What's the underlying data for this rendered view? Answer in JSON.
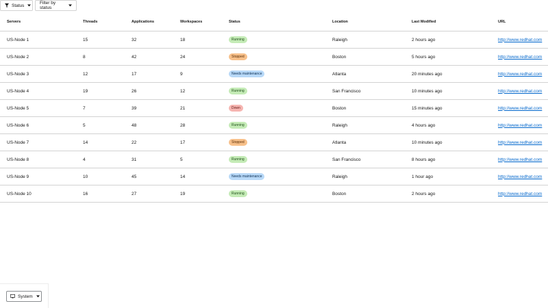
{
  "toolbar": {
    "status_label": "Status",
    "filter_label": "Filter by status"
  },
  "table": {
    "headers": [
      "Servers",
      "Threads",
      "Applications",
      "Workspaces",
      "Status",
      "Location",
      "Last Modified",
      "URL"
    ],
    "rows": [
      {
        "server": "US-Node 1",
        "threads": "15",
        "applications": "32",
        "workspaces": "18",
        "status": "Running",
        "status_kind": "running",
        "location": "Raleigh",
        "modified": "2 hours ago",
        "url": "http://www.redhat.com"
      },
      {
        "server": "US-Node 2",
        "threads": "8",
        "applications": "42",
        "workspaces": "24",
        "status": "Stopped",
        "status_kind": "stopped",
        "location": "Boston",
        "modified": "5 hours ago",
        "url": "http://www.redhat.com"
      },
      {
        "server": "US-Node 3",
        "threads": "12",
        "applications": "17",
        "workspaces": "9",
        "status": "Needs maintenance",
        "status_kind": "maint",
        "location": "Atlanta",
        "modified": "20 minutes ago",
        "url": "http://www.redhat.com"
      },
      {
        "server": "US-Node 4",
        "threads": "19",
        "applications": "26",
        "workspaces": "12",
        "status": "Running",
        "status_kind": "running",
        "location": "San Francisco",
        "modified": "10 minutes ago",
        "url": "http://www.redhat.com"
      },
      {
        "server": "US-Node 5",
        "threads": "7",
        "applications": "39",
        "workspaces": "21",
        "status": "Down",
        "status_kind": "down",
        "location": "Boston",
        "modified": "15 minutes ago",
        "url": "http://www.redhat.com"
      },
      {
        "server": "US-Node 6",
        "threads": "5",
        "applications": "48",
        "workspaces": "28",
        "status": "Running",
        "status_kind": "running",
        "location": "Raleigh",
        "modified": "4 hours ago",
        "url": "http://www.redhat.com"
      },
      {
        "server": "US-Node 7",
        "threads": "14",
        "applications": "22",
        "workspaces": "17",
        "status": "Stopped",
        "status_kind": "stopped",
        "location": "Atlanta",
        "modified": "10 minutes ago",
        "url": "http://www.redhat.com"
      },
      {
        "server": "US-Node 8",
        "threads": "4",
        "applications": "31",
        "workspaces": "5",
        "status": "Running",
        "status_kind": "running",
        "location": "San Francisco",
        "modified": "8 hours ago",
        "url": "http://www.redhat.com"
      },
      {
        "server": "US-Node 9",
        "threads": "10",
        "applications": "45",
        "workspaces": "14",
        "status": "Needs maintenance",
        "status_kind": "maint",
        "location": "Raleigh",
        "modified": "1 hour ago",
        "url": "http://www.redhat.com"
      },
      {
        "server": "US-Node 10",
        "threads": "16",
        "applications": "27",
        "workspaces": "19",
        "status": "Running",
        "status_kind": "running",
        "location": "Boston",
        "modified": "2 hours ago",
        "url": "http://www.redhat.com"
      }
    ]
  },
  "theme_selector": {
    "label": "System",
    "icon": "monitor-icon"
  },
  "colors": {
    "link": "#0066cc",
    "running": "#c4ebb6",
    "stopped": "#f7c08a",
    "needs_maintenance": "#b8d9f8",
    "down": "#f6b5b1",
    "border": "#d2d2d2"
  }
}
